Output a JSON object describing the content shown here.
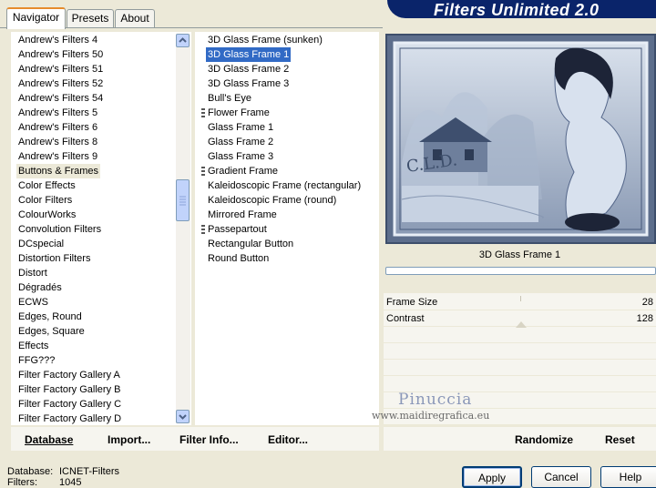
{
  "app": {
    "title": "Filters Unlimited 2.0"
  },
  "tabs": [
    {
      "label": "Navigator",
      "active": true
    },
    {
      "label": "Presets",
      "active": false
    },
    {
      "label": "About",
      "active": false
    }
  ],
  "categories": {
    "items": [
      "Andrew's Filters 4",
      "Andrew's Filters 50",
      "Andrew's Filters 51",
      "Andrew's Filters 52",
      "Andrew's Filters 54",
      "Andrew's Filters 5",
      "Andrew's Filters 6",
      "Andrew's Filters 8",
      "Andrew's Filters 9",
      "Buttons & Frames",
      "Color Effects",
      "Color Filters",
      "ColourWorks",
      "Convolution Filters",
      "DCspecial",
      "Distortion Filters",
      "Distort",
      "Dégradés",
      "ECWS",
      "Edges, Round",
      "Edges, Square",
      "Effects",
      "FFG???",
      "Filter Factory Gallery A",
      "Filter Factory Gallery B",
      "Filter Factory Gallery C",
      "Filter Factory Gallery D"
    ],
    "selected": "Buttons & Frames"
  },
  "filters": {
    "items": [
      "3D Glass Frame (sunken)",
      "3D Glass Frame 1",
      "3D Glass Frame 2",
      "3D Glass Frame 3",
      "Bull's Eye",
      "Flower Frame",
      "Glass Frame 1",
      "Glass Frame 2",
      "Glass Frame 3",
      "Gradient Frame",
      "Kaleidoscopic Frame (rectangular)",
      "Kaleidoscopic Frame (round)",
      "Mirrored Frame",
      "Passepartout",
      "Rectangular Button",
      "Round Button"
    ],
    "selected": "3D Glass Frame 1"
  },
  "preview": {
    "filter_name": "3D Glass Frame 1",
    "progress": 0,
    "image_signature": "C.L.D."
  },
  "params": [
    {
      "label": "Frame Size",
      "value": "28"
    },
    {
      "label": "Contrast",
      "value": "128"
    }
  ],
  "watermark": {
    "line1": "Pinuccia",
    "line2": "www.maidiregrafica.eu"
  },
  "left_buttons": [
    {
      "label": "Database"
    },
    {
      "label": "Import..."
    },
    {
      "label": "Filter Info..."
    },
    {
      "label": "Editor..."
    }
  ],
  "right_buttons": [
    {
      "label": "Randomize"
    },
    {
      "label": "Reset"
    }
  ],
  "status": {
    "database_label": "Database:",
    "database_value": "ICNET-Filters",
    "filters_label": "Filters:",
    "filters_value": "1045"
  },
  "dialog_buttons": {
    "apply": "Apply",
    "cancel": "Cancel",
    "help": "Help"
  },
  "colors": {
    "banner": "#0a246a",
    "selection": "#316ac5",
    "background": "#ece9d8"
  }
}
